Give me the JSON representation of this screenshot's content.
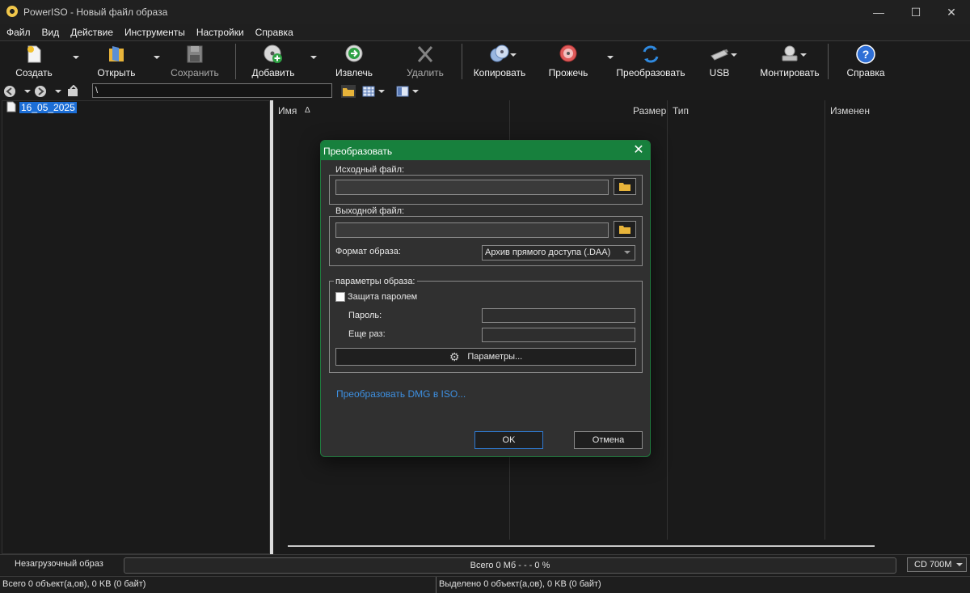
{
  "window": {
    "title": "PowerISO - Новый файл образа"
  },
  "menu": [
    "Файл",
    "Вид",
    "Действие",
    "Инструменты",
    "Настройки",
    "Справка"
  ],
  "toolbar": {
    "create": "Создать",
    "open": "Открыть",
    "save": "Сохранить",
    "add": "Добавить",
    "extract": "Извлечь",
    "delete": "Удалить",
    "copy": "Копировать",
    "burn": "Прожечь",
    "convert": "Преобразовать",
    "usb": "USB",
    "mount": "Монтировать",
    "help": "Справка"
  },
  "address": {
    "path": "\\"
  },
  "tree": {
    "root": "16_05_2025"
  },
  "columns": {
    "name": "Имя",
    "sort_indicator": "Δ",
    "size": "Размер",
    "type": "Тип",
    "modified": "Изменен"
  },
  "dialog": {
    "title": "Преобразовать",
    "source_group": "Исходный файл:",
    "source_value": "",
    "output_group": "Выходной файл:",
    "output_value": "",
    "format_label": "Формат образа:",
    "format_value": "Архив прямого доступа (.DAA)",
    "params_group": "параметры образа:",
    "password_protect": "Защита паролем",
    "password_protect_checked": false,
    "password_label": "Пароль:",
    "password_repeat_label": "Еще раз:",
    "params_button": "Параметры...",
    "dmg_link": "Преобразовать DMG в ISO...",
    "ok": "OK",
    "cancel": "Отмена"
  },
  "status": {
    "boot": "Незагрузочный образ",
    "progress_text": "Всего  0 Мб   - - -  0 %",
    "progress_percent": 0,
    "media": "CD 700M",
    "total": "Всего 0 объект(а,ов), 0 KB (0 байт)",
    "selected": "Выделено 0 объект(а,ов), 0 KB (0 байт)"
  },
  "colors": {
    "accent_green": "#17803d",
    "selection_blue": "#1c6ed6",
    "link_blue": "#3d8fe0"
  }
}
